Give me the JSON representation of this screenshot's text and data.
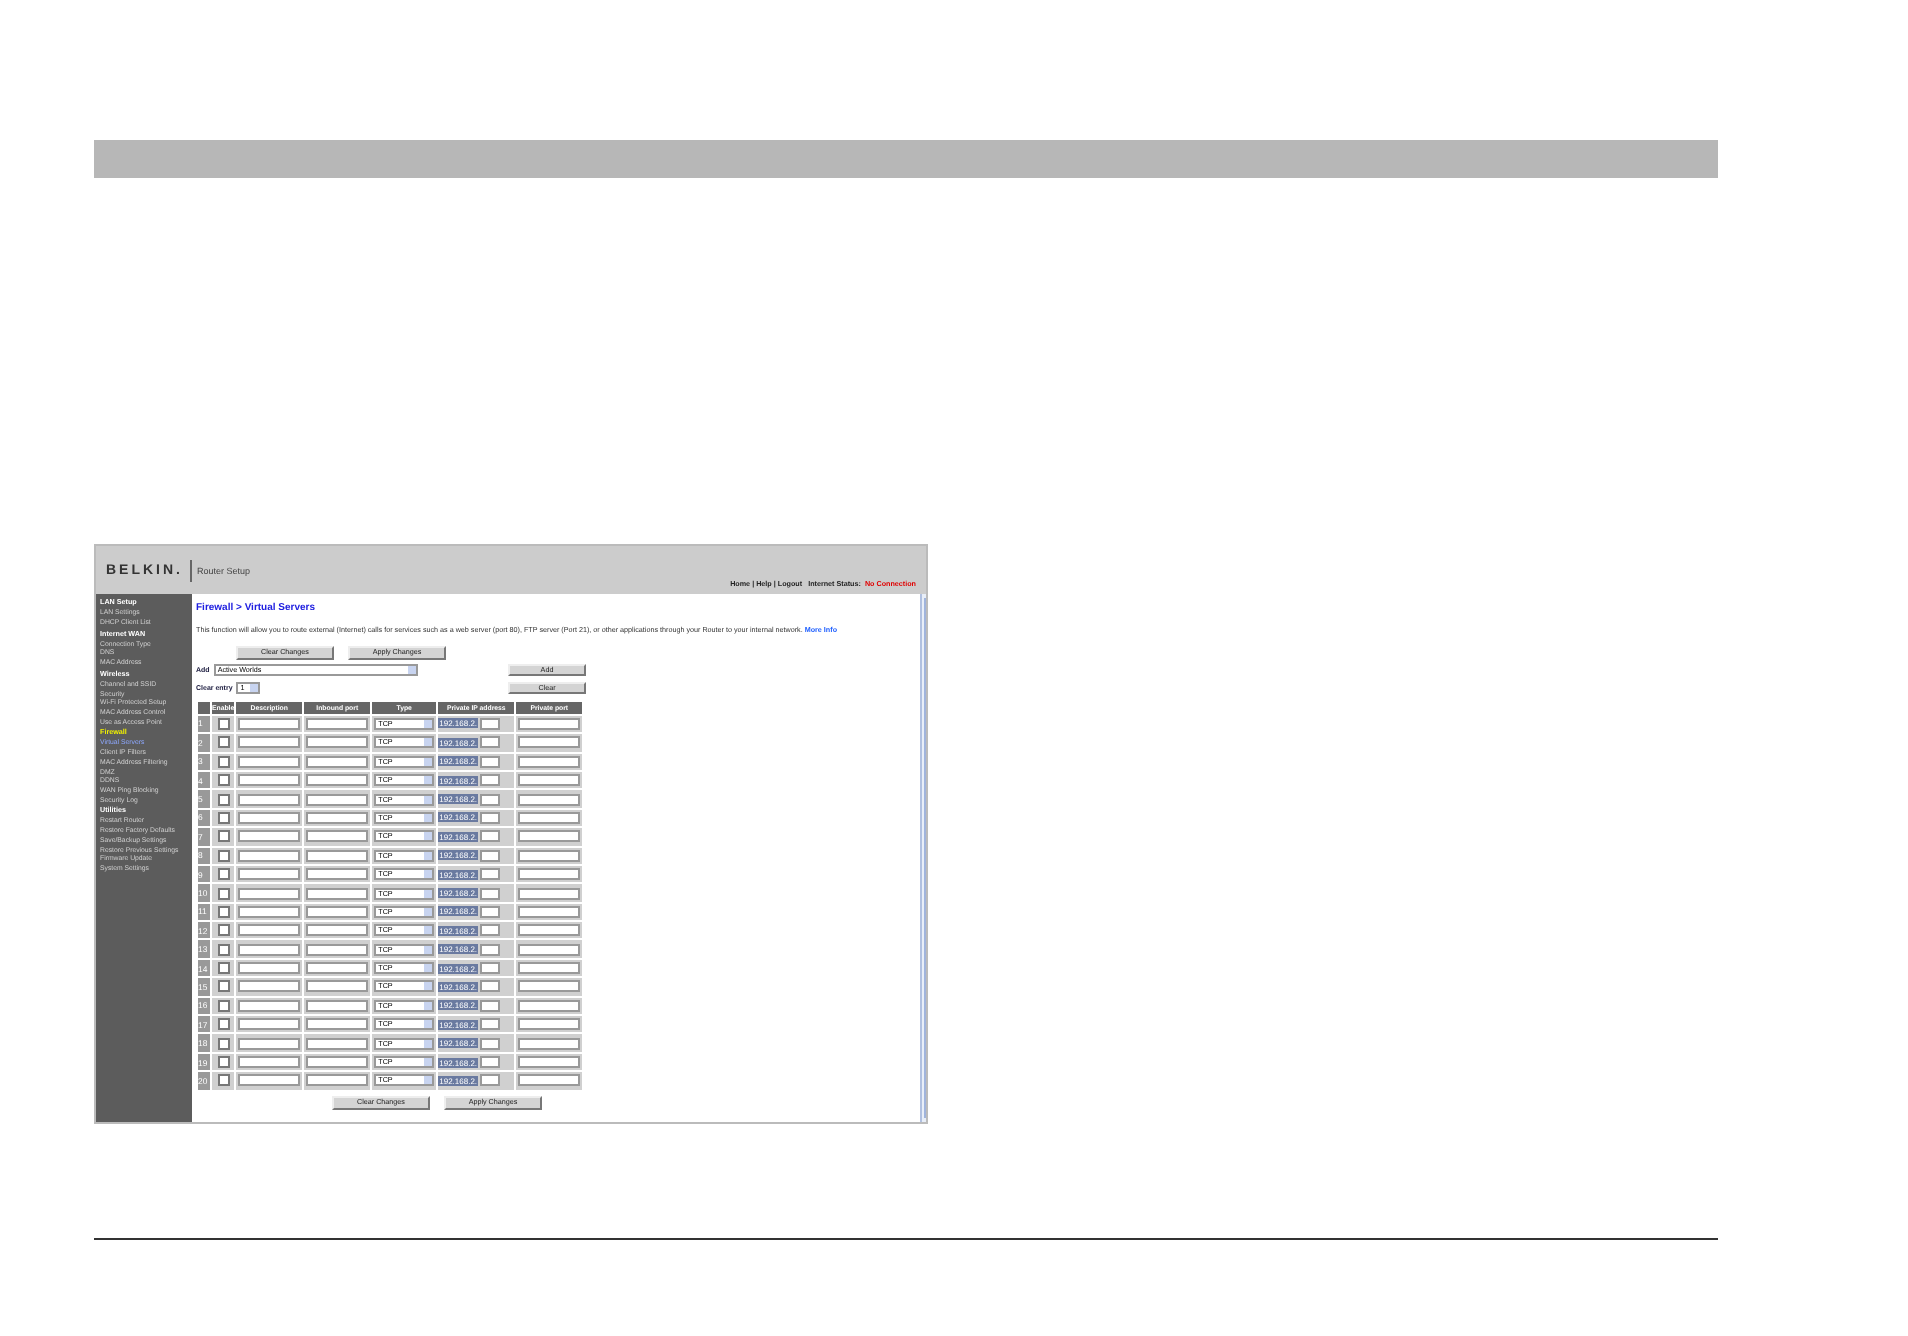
{
  "header": {
    "logo": "BELKIN.",
    "title": "Router Setup",
    "links": [
      "Home",
      "Help",
      "Logout"
    ],
    "separator": "|",
    "status_label": "Internet Status:",
    "status_value": "No Connection"
  },
  "sidebar": [
    {
      "heading": "LAN Setup",
      "active": false,
      "items": [
        {
          "label": "LAN Settings",
          "selected": false
        },
        {
          "label": "DHCP Client List",
          "selected": false
        }
      ]
    },
    {
      "heading": "Internet WAN",
      "active": false,
      "items": [
        {
          "label": "Connection Type",
          "selected": false
        },
        {
          "label": "DNS",
          "selected": false
        },
        {
          "label": "MAC Address",
          "selected": false
        }
      ]
    },
    {
      "heading": "Wireless",
      "active": false,
      "items": [
        {
          "label": "Channel and SSID",
          "selected": false
        },
        {
          "label": "Security",
          "selected": false
        },
        {
          "label": "Wi-Fi Protected Setup",
          "selected": false
        },
        {
          "label": "MAC Address Control",
          "selected": false
        },
        {
          "label": "Use as Access Point",
          "selected": false
        }
      ]
    },
    {
      "heading": "Firewall",
      "active": true,
      "items": [
        {
          "label": "Virtual Servers",
          "selected": true
        },
        {
          "label": "Client IP Filters",
          "selected": false
        },
        {
          "label": "MAC Address Filtering",
          "selected": false
        },
        {
          "label": "DMZ",
          "selected": false
        },
        {
          "label": "DDNS",
          "selected": false
        },
        {
          "label": "WAN Ping Blocking",
          "selected": false
        },
        {
          "label": "Security Log",
          "selected": false
        }
      ]
    },
    {
      "heading": "Utilities",
      "active": false,
      "items": [
        {
          "label": "Restart Router",
          "selected": false
        },
        {
          "label": "Restore Factory Defaults",
          "selected": false
        },
        {
          "label": "Save/Backup Settings",
          "selected": false
        },
        {
          "label": "Restore Previous Settings",
          "selected": false
        },
        {
          "label": "Firmware Update",
          "selected": false
        },
        {
          "label": "System Settings",
          "selected": false
        }
      ]
    }
  ],
  "content": {
    "title": "Firewall > Virtual Servers",
    "intro": "This function will allow you to route external (Internet) calls for services such as a web server (port 80), FTP server (Port 21), or other applications through your Router to your internal network.",
    "more_info": "More Info",
    "top_buttons": [
      "Clear Changes",
      "Apply Changes"
    ],
    "add_label": "Add",
    "add_select": "Active Worlds",
    "add_button": "Add",
    "clear_label": "Clear entry",
    "clear_select": "1",
    "clear_button": "Clear",
    "columns": [
      "Enable",
      "Description",
      "Inbound port",
      "Type",
      "Private IP address",
      "Private port"
    ],
    "rows": [
      {
        "number": "1",
        "enabled": false,
        "type": "TCP",
        "ip_prefix": "192.168.2."
      },
      {
        "number": "2",
        "enabled": false,
        "type": "TCP",
        "ip_prefix": "192.168.2."
      },
      {
        "number": "3",
        "enabled": false,
        "type": "TCP",
        "ip_prefix": "192.168.2."
      },
      {
        "number": "4",
        "enabled": false,
        "type": "TCP",
        "ip_prefix": "192.168.2."
      },
      {
        "number": "5",
        "enabled": false,
        "type": "TCP",
        "ip_prefix": "192.168.2."
      },
      {
        "number": "6",
        "enabled": false,
        "type": "TCP",
        "ip_prefix": "192.168.2."
      },
      {
        "number": "7",
        "enabled": false,
        "type": "TCP",
        "ip_prefix": "192.168.2."
      },
      {
        "number": "8",
        "enabled": false,
        "type": "TCP",
        "ip_prefix": "192.168.2."
      },
      {
        "number": "9",
        "enabled": false,
        "type": "TCP",
        "ip_prefix": "192.168.2."
      },
      {
        "number": "10",
        "enabled": false,
        "type": "TCP",
        "ip_prefix": "192.168.2."
      },
      {
        "number": "11",
        "enabled": false,
        "type": "TCP",
        "ip_prefix": "192.168.2."
      },
      {
        "number": "12",
        "enabled": false,
        "type": "TCP",
        "ip_prefix": "192.168.2."
      },
      {
        "number": "13",
        "enabled": false,
        "type": "TCP",
        "ip_prefix": "192.168.2."
      },
      {
        "number": "14",
        "enabled": false,
        "type": "TCP",
        "ip_prefix": "192.168.2."
      },
      {
        "number": "15",
        "enabled": false,
        "type": "TCP",
        "ip_prefix": "192.168.2."
      },
      {
        "number": "16",
        "enabled": false,
        "type": "TCP",
        "ip_prefix": "192.168.2."
      },
      {
        "number": "17",
        "enabled": false,
        "type": "TCP",
        "ip_prefix": "192.168.2."
      },
      {
        "number": "18",
        "enabled": false,
        "type": "TCP",
        "ip_prefix": "192.168.2."
      },
      {
        "number": "19",
        "enabled": false,
        "type": "TCP",
        "ip_prefix": "192.168.2."
      },
      {
        "number": "20",
        "enabled": false,
        "type": "TCP",
        "ip_prefix": "192.168.2."
      }
    ],
    "bottom_buttons": [
      "Clear Changes",
      "Apply Changes"
    ]
  }
}
